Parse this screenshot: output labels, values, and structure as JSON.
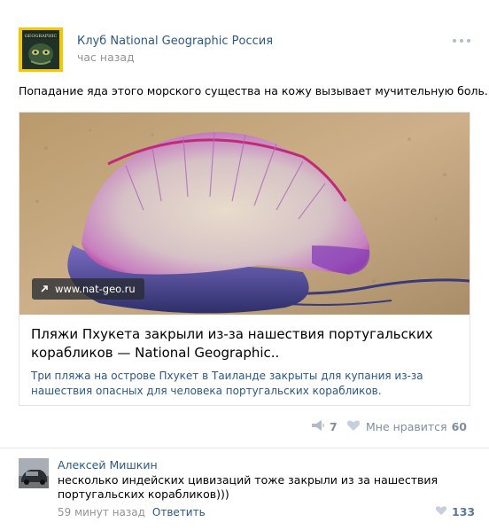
{
  "post": {
    "group_name": "Клуб National Geographic Россия",
    "time": "час назад",
    "text": "Попадание яда этого морского существа на кожу вызывает мучительную боль.",
    "link": {
      "domain": "www.nat-geo.ru",
      "title": "Пляжи Пхукета закрыли из-за нашествия португальских корабликов — National Geographic..",
      "description": "Три пляжа на острове Пхукет в Таиланде закрыты для купания из-за нашествия опасных для человека португальских корабликов."
    },
    "share_count": "7",
    "like_label": "Мне нравится",
    "like_count": "60"
  },
  "avatar_logo_text": "GEOGRAPHIC",
  "comment": {
    "author": "Алексей Мишкин",
    "text": "несколько индейских цивизаций тоже закрыли из за нашествия португальских корабликов)))",
    "time": "59 минут назад",
    "reply_label": "Ответить",
    "like_count": "133"
  },
  "icons": [
    "more-icon",
    "external-link-icon",
    "share-icon",
    "heart-icon"
  ],
  "colors": {
    "link": "#2a5885",
    "muted": "#939393",
    "action": "#7d8ea0",
    "jellyfish": "#c44ea8"
  }
}
